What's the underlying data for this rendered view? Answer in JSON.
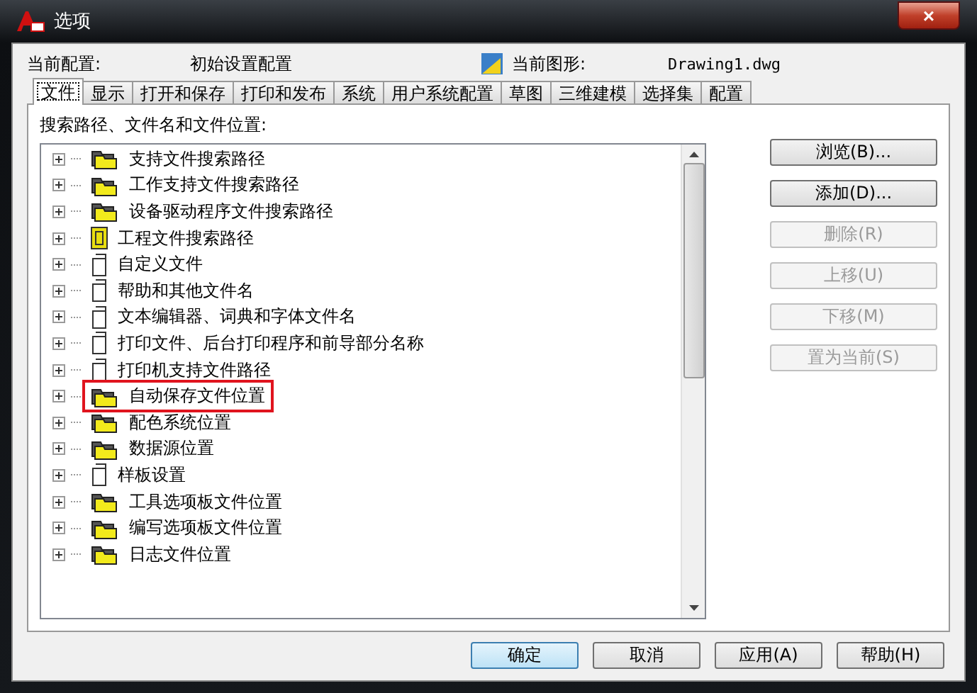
{
  "window": {
    "title": "选项",
    "close_label": "×"
  },
  "header": {
    "profile_label": "当前配置:",
    "profile_value": "初始设置配置",
    "drawing_label": "当前图形:",
    "drawing_value": "Drawing1.dwg"
  },
  "tabs": [
    {
      "label": "文件",
      "selected": true
    },
    {
      "label": "显示",
      "selected": false
    },
    {
      "label": "打开和保存",
      "selected": false
    },
    {
      "label": "打印和发布",
      "selected": false
    },
    {
      "label": "系统",
      "selected": false
    },
    {
      "label": "用户系统配置",
      "selected": false
    },
    {
      "label": "草图",
      "selected": false
    },
    {
      "label": "三维建模",
      "selected": false
    },
    {
      "label": "选择集",
      "selected": false
    },
    {
      "label": "配置",
      "selected": false
    }
  ],
  "list_label": "搜索路径、文件名和文件位置:",
  "tree": [
    {
      "label": "支持文件搜索路径",
      "kind": "folders",
      "highlighted": false
    },
    {
      "label": "工作支持文件搜索路径",
      "kind": "folders",
      "highlighted": false
    },
    {
      "label": "设备驱动程序文件搜索路径",
      "kind": "folders",
      "highlighted": false
    },
    {
      "label": "工程文件搜索路径",
      "kind": "book",
      "highlighted": false
    },
    {
      "label": "自定义文件",
      "kind": "page",
      "highlighted": false
    },
    {
      "label": "帮助和其他文件名",
      "kind": "page",
      "highlighted": false
    },
    {
      "label": "文本编辑器、词典和字体文件名",
      "kind": "page",
      "highlighted": false
    },
    {
      "label": "打印文件、后台打印程序和前导部分名称",
      "kind": "page",
      "highlighted": false
    },
    {
      "label": "打印机支持文件路径",
      "kind": "page",
      "highlighted": false
    },
    {
      "label": "自动保存文件位置",
      "kind": "folders",
      "highlighted": true
    },
    {
      "label": "配色系统位置",
      "kind": "folders",
      "highlighted": false
    },
    {
      "label": "数据源位置",
      "kind": "folders",
      "highlighted": false
    },
    {
      "label": "样板设置",
      "kind": "page",
      "highlighted": false
    },
    {
      "label": "工具选项板文件位置",
      "kind": "folders",
      "highlighted": false
    },
    {
      "label": "编写选项板文件位置",
      "kind": "folders",
      "highlighted": false
    },
    {
      "label": "日志文件位置",
      "kind": "folders",
      "highlighted": false
    }
  ],
  "side_buttons": [
    {
      "label": "浏览(B)...",
      "disabled": false
    },
    {
      "label": "添加(D)...",
      "disabled": false
    },
    {
      "label": "删除(R)",
      "disabled": true
    },
    {
      "label": "上移(U)",
      "disabled": true
    },
    {
      "label": "下移(M)",
      "disabled": true
    },
    {
      "label": "置为当前(S)",
      "disabled": true
    }
  ],
  "footer_buttons": [
    {
      "label": "确定",
      "default": true
    },
    {
      "label": "取消",
      "default": false
    },
    {
      "label": "应用(A)",
      "default": false
    },
    {
      "label": "帮助(H)",
      "default": false
    }
  ]
}
